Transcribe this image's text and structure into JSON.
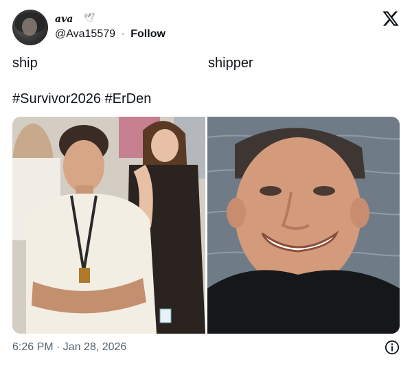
{
  "tweet": {
    "display_name": "ava",
    "name_emoji": "🕊",
    "handle": "@Ava15579",
    "separator": "·",
    "follow_label": "Follow",
    "text_line_left": "ship",
    "text_line_right": "shipper",
    "hashtags": "#Survivor2026 #ErDen",
    "timestamp": "6:26 PM · Jan 28, 2026"
  },
  "icons": {
    "logo": "x-logo-icon",
    "info": "info-icon"
  },
  "colors": {
    "text_primary": "#0f1419",
    "text_secondary": "#536471",
    "background": "#ffffff"
  }
}
